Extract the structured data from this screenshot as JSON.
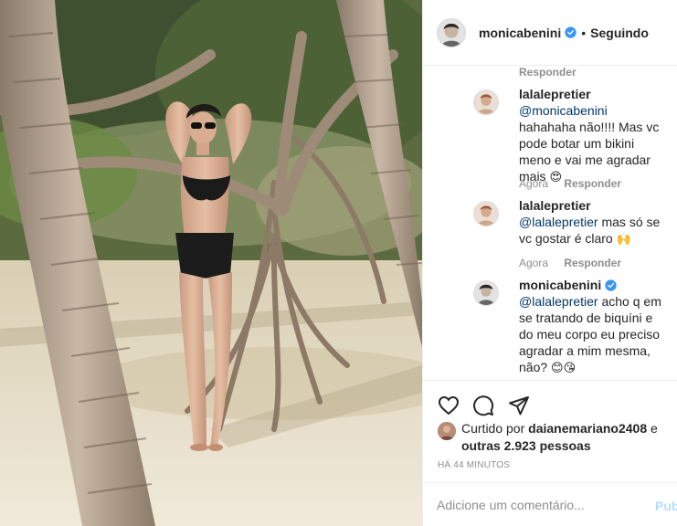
{
  "post": {
    "username": "monicabenini",
    "follow_status": "Seguindo",
    "dot": "•"
  },
  "comments": {
    "top_reply_label": "Responder",
    "items": [
      {
        "username": "lalalepretier",
        "mention": "@monicabenini",
        "text": " hahahaha não!!!! Mas vc pode botar um bikini meno e vai me agradar mais ",
        "emoji": "😍",
        "time": "Agora",
        "reply": "Responder"
      },
      {
        "username": "lalalepretier",
        "mention": "@lalalepretier",
        "text": " mas só se vc gostar é claro ",
        "emoji": "🙌",
        "time": "Agora",
        "reply": "Responder"
      },
      {
        "username": "monicabenini",
        "mention": "@lalalepretier",
        "text": " acho q em se tratando de biquíni e do meu corpo eu preciso agradar a mim mesma, não? ",
        "emoji": "😊😘"
      }
    ]
  },
  "actions": {
    "like_icon": "heart-icon",
    "comment_icon": "comment-icon",
    "share_icon": "share-icon"
  },
  "likes": {
    "prefix": "Curtido por ",
    "user": "daianemariano2408",
    "mid": " e ",
    "others": "outras 2.923 pessoas"
  },
  "timestamp": "HÁ 44 MINUTOS",
  "add_comment": {
    "placeholder": "Adicione um comentário...",
    "publish": "Pub"
  },
  "colors": {
    "verified": "#3897f0",
    "mention": "#00376b",
    "muted": "#8e8e8e",
    "publish_disabled": "#b2dffc"
  }
}
